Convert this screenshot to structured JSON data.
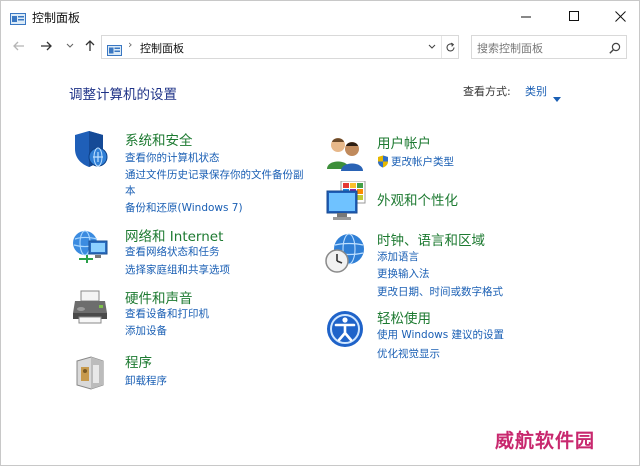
{
  "window": {
    "title": "控制面板"
  },
  "nav": {
    "address": {
      "separator": "›",
      "location": "控制面板"
    },
    "search": {
      "placeholder": "搜索控制面板"
    }
  },
  "header": {
    "title": "调整计算机的设置",
    "view_by_label": "查看方式:",
    "view_by_value": "类别"
  },
  "categories": [
    {
      "id": "system-security",
      "icon": "shield-icon",
      "title": "系统和安全",
      "links": [
        "查看你的计算机状态",
        "通过文件历史记录保存你的文件备份副",
        "本",
        "备份和还原(Windows 7)"
      ]
    },
    {
      "id": "network",
      "icon": "network-icon",
      "title": "网络和 Internet",
      "links": [
        "查看网络状态和任务",
        "选择家庭组和共享选项"
      ]
    },
    {
      "id": "hardware",
      "icon": "printer-icon",
      "title": "硬件和声音",
      "links": [
        "查看设备和打印机",
        "添加设备"
      ]
    },
    {
      "id": "programs",
      "icon": "programs-icon",
      "title": "程序",
      "links": [
        "卸载程序"
      ]
    },
    {
      "id": "user-accounts",
      "icon": "users-icon",
      "title": "用户帐户",
      "links": [
        "更改帐户类型"
      ]
    },
    {
      "id": "appearance",
      "icon": "appearance-icon",
      "title": "外观和个性化",
      "links": []
    },
    {
      "id": "clock",
      "icon": "clock-globe-icon",
      "title": "时钟、语言和区域",
      "links": [
        "添加语言",
        "更换输入法",
        "更改日期、时间或数字格式"
      ]
    },
    {
      "id": "ease",
      "icon": "ease-of-access-icon",
      "title": "轻松使用",
      "links": [
        "使用 Windows 建议的设置",
        "优化视觉显示"
      ]
    }
  ],
  "watermark": "威航软件园"
}
